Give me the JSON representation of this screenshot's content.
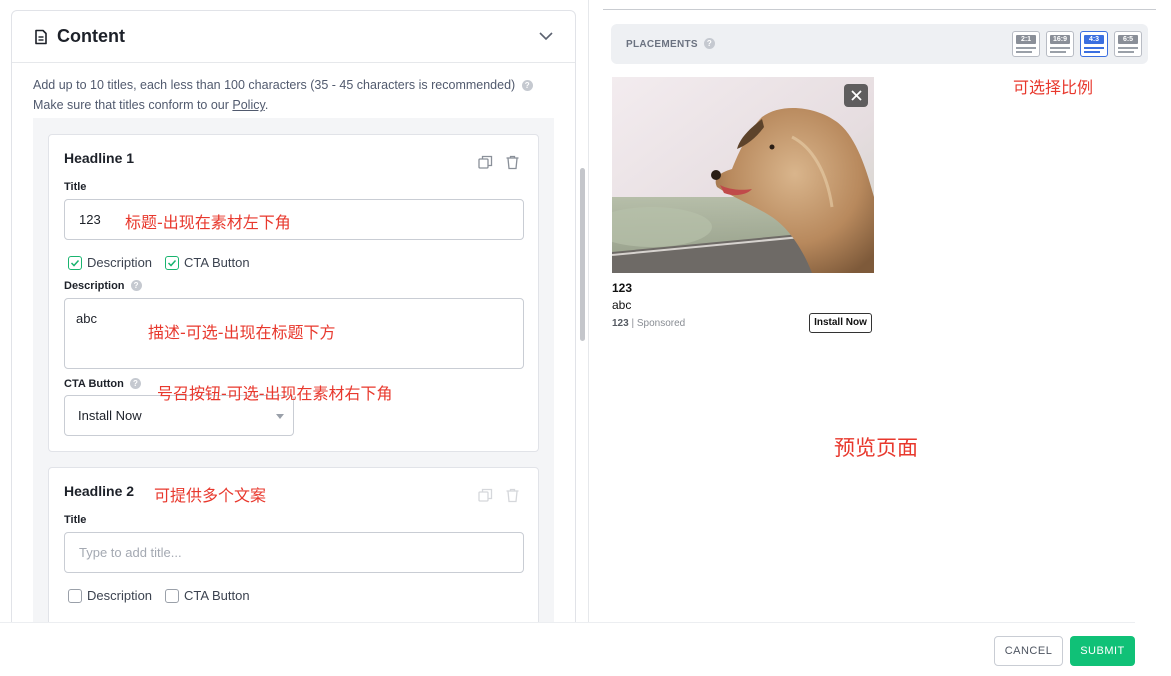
{
  "content_card": {
    "title": "Content",
    "intro_line1": "Add up to 10 titles, each less than 100 characters (35 - 45 characters is recommended)",
    "intro_line2_prefix": "Make sure that titles conform to our ",
    "policy_link": "Policy",
    "intro_line2_suffix": "."
  },
  "headline1": {
    "title": "Headline 1",
    "title_label": "Title",
    "title_value": "123",
    "desc_checkbox": "Description",
    "cta_checkbox": "CTA Button",
    "description_label": "Description",
    "description_value": "abc",
    "cta_label": "CTA Button",
    "cta_value": "Install Now"
  },
  "headline2": {
    "title": "Headline 2",
    "title_label": "Title",
    "title_placeholder": "Type to add title...",
    "desc_checkbox": "Description",
    "cta_checkbox": "CTA Button"
  },
  "annotations": {
    "title_note": "标题-出现在素材左下角",
    "desc_note": "描述-可选-出现在标题下方",
    "cta_note": "号召按钮-可选-出现在素材右下角",
    "multi_note": "可提供多个文案",
    "ratio_note": "可选择比例",
    "preview_note": "预览页面"
  },
  "placements": {
    "label": "PLACEMENTS",
    "ratios": [
      "2:1",
      "16:9",
      "4:3",
      "6:5"
    ],
    "active_ratio": "4:3"
  },
  "preview": {
    "title": "123",
    "description": "abc",
    "brand": "123",
    "sponsored": "Sponsored",
    "cta": "Install Now"
  },
  "footer": {
    "cancel": "CANCEL",
    "submit": "SUBMIT"
  },
  "colors": {
    "accent_green": "#10c177",
    "annotation_red": "#e8382d",
    "active_blue": "#3b6fe0"
  }
}
